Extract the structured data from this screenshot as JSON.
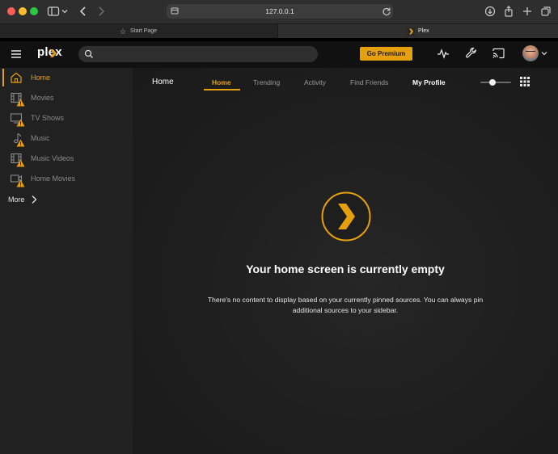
{
  "browser": {
    "url": "127.0.0.1",
    "tabs": [
      {
        "label": "Start Page"
      },
      {
        "label": "Plex"
      }
    ]
  },
  "app": {
    "logo": "plex",
    "search_placeholder": "",
    "premium_label": "Go Premium"
  },
  "sidebar": {
    "items": [
      {
        "label": "Home",
        "icon": "home-icon",
        "active": true
      },
      {
        "label": "Movies",
        "icon": "film-icon",
        "warning": true
      },
      {
        "label": "TV Shows",
        "icon": "tv-icon",
        "warning": true
      },
      {
        "label": "Music",
        "icon": "music-note-icon",
        "warning": true
      },
      {
        "label": "Music Videos",
        "icon": "film-icon",
        "warning": true
      },
      {
        "label": "Home Movies",
        "icon": "video-camera-icon",
        "warning": true
      }
    ],
    "more_label": "More"
  },
  "main": {
    "section_title": "Home",
    "tabs": [
      {
        "label": "Home",
        "active": true
      },
      {
        "label": "Trending"
      },
      {
        "label": "Activity"
      },
      {
        "label": "Find Friends"
      },
      {
        "label": "My Profile"
      }
    ],
    "empty_title": "Your home screen is currently empty",
    "empty_line1": "There's no content to display based on your currently pinned sources. You can always pin",
    "empty_line2": "additional sources to your sidebar."
  },
  "colors": {
    "accent": "#e5a00d",
    "background": "#1c1c1c",
    "topbar": "#111111",
    "sidebar": "#212121"
  }
}
